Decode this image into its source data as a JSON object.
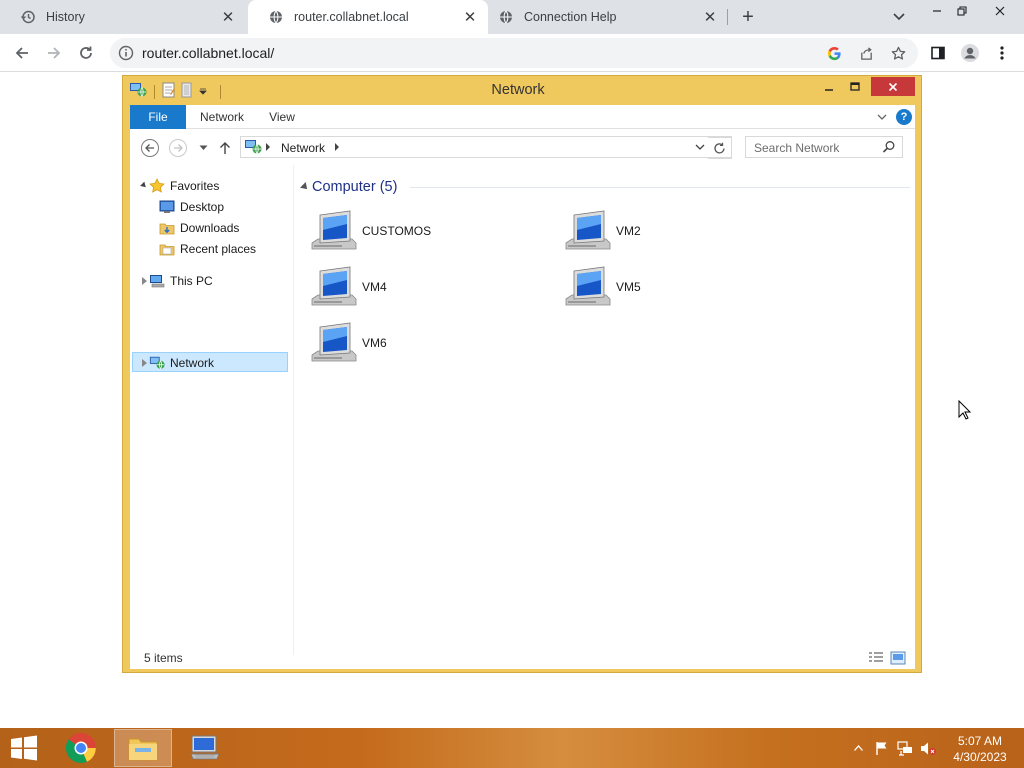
{
  "browser": {
    "tabs": [
      {
        "title": "History",
        "icon": "history-icon"
      },
      {
        "title": "router.collabnet.local",
        "icon": "globe-icon",
        "active": true
      },
      {
        "title": "Connection Help",
        "icon": "globe-icon"
      }
    ],
    "close_glyph": "✕",
    "new_tab_glyph": "+",
    "url": "router.collabnet.local/"
  },
  "explorer": {
    "window_title": "Network",
    "ribbon_tabs": [
      "File",
      "Network",
      "View"
    ],
    "help_glyph": "?",
    "address_crumb": "Network",
    "search_placeholder": "Search Network",
    "nav_pane": {
      "favorites_label": "Favorites",
      "favorites_items": [
        "Desktop",
        "Downloads",
        "Recent places"
      ],
      "this_pc_label": "This PC",
      "network_label": "Network"
    },
    "group_header": "Computer (5)",
    "computers": [
      "CUSTOMOS",
      "VM2",
      "VM4",
      "VM5",
      "VM6"
    ],
    "status_count": "5 items"
  },
  "taskbar": {
    "time": "5:07 AM",
    "date": "4/30/2023"
  },
  "colors": {
    "explorer_frame": "#f0c95e",
    "file_tab": "#1979ca",
    "close_button": "#c7383a",
    "selection": "#cce8ff",
    "group_header": "#1e3287"
  }
}
